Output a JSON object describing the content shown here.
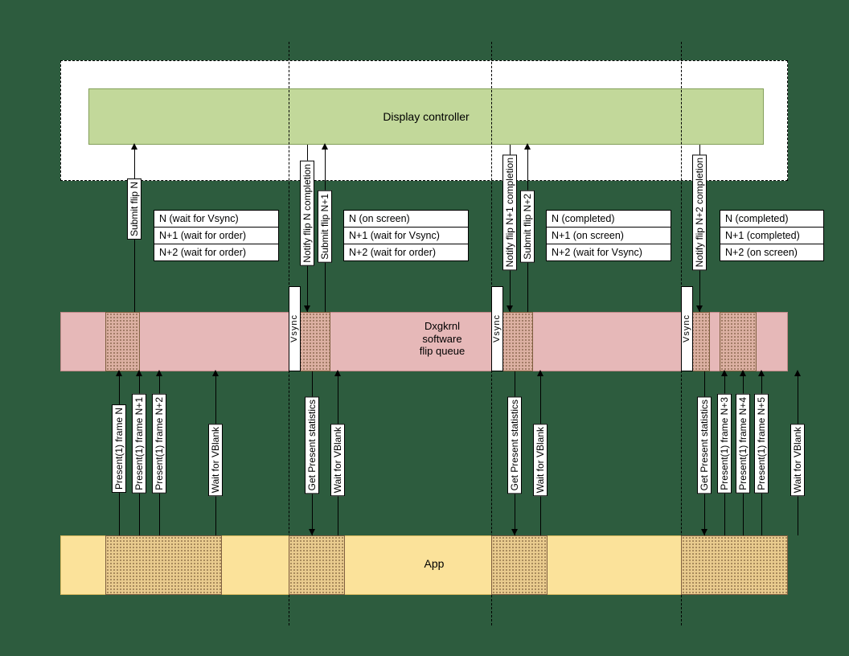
{
  "display_controller": "Display controller",
  "dxgkrnl_label": "Dxgkrnl\nsoftware\nflip queue",
  "app_label": "App",
  "vsync": "Vsync",
  "tables": {
    "t1": [
      "N (wait for Vsync)",
      "N+1 (wait for order)",
      "N+2 (wait for order)"
    ],
    "t2": [
      "N (on screen)",
      "N+1 (wait for Vsync)",
      "N+2 (wait for order)"
    ],
    "t3": [
      "N (completed)",
      "N+1 (on screen)",
      "N+2 (wait for Vsync)"
    ],
    "t4": [
      "N (completed)",
      "N+1 (completed)",
      "N+2 (on screen)"
    ]
  },
  "top_labels": {
    "submit_n": "Submit flip N",
    "notify_n": "Notify flip N completion",
    "submit_n1": "Submit flip N+1",
    "notify_n1": "Notify flip N+1 completion",
    "submit_n2": "Submit flip N+2",
    "notify_n2": "Notify flip N+2 completion"
  },
  "bottom_labels": {
    "present_n": "Present(1) frame N",
    "present_n1": "Present(1) frame N+1",
    "present_n2": "Present(1) frame N+2",
    "present_n3": "Present(1) frame N+3",
    "present_n4": "Present(1) frame N+4",
    "present_n5": "Present(1) frame N+5",
    "wait_vblank": "Wait for VBlank",
    "get_stats": "Get Present statistics"
  }
}
